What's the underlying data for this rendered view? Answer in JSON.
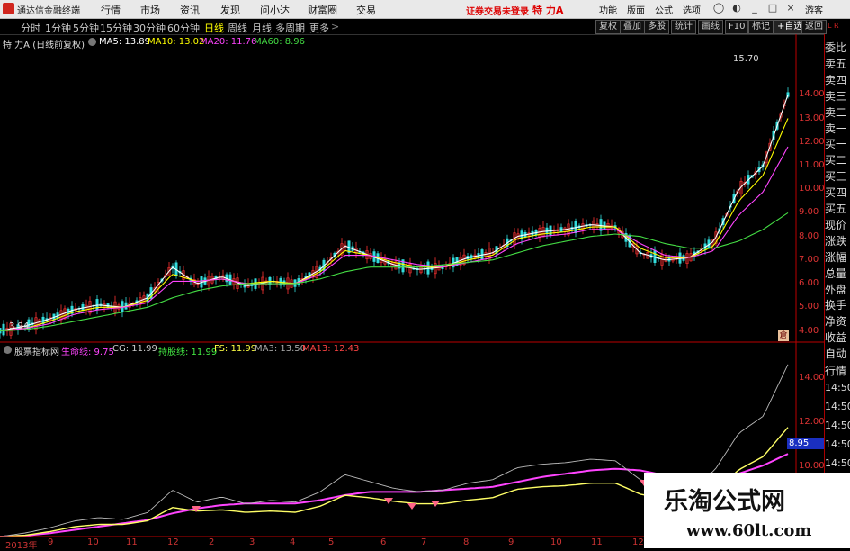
{
  "menubar": {
    "app_name": "通达信金融终端",
    "items": [
      "行情",
      "市场",
      "资讯",
      "发现",
      "问小达",
      "财富圈",
      "交易"
    ],
    "status_text": "证券交易未登录",
    "stock_name": "特 力A",
    "right_items": [
      "功能",
      "版面",
      "公式",
      "选项"
    ],
    "guest": "游客"
  },
  "toolbar": {
    "periods": [
      "分时",
      "1分钟",
      "5分钟",
      "15分钟",
      "30分钟",
      "60分钟",
      "日线",
      "周线",
      "月线",
      "多周期",
      "更多"
    ],
    "active_period": "日线",
    "buttons": [
      "复权",
      "叠加",
      "多股",
      "统计",
      "画线",
      "F10",
      "标记",
      "+自选",
      "返回"
    ]
  },
  "main_indicator": {
    "title": "特 力A (日线前复权)",
    "items": [
      {
        "label": "MA5: 13.89",
        "color": "#ffffff"
      },
      {
        "label": "MA10: 13.02",
        "color": "#ffff00"
      },
      {
        "label": "MA20: 11.76",
        "color": "#ff44ff"
      },
      {
        "label": "MA60: 8.96",
        "color": "#44dd44"
      }
    ]
  },
  "sub_indicator": {
    "title": "股票指标网",
    "items": [
      {
        "label": "生命线: 9.75",
        "color": "#ff44ff"
      },
      {
        "label": "CG: 11.99",
        "color": "#cccccc"
      },
      {
        "label": "持股线: 11.99",
        "color": "#44ee44"
      },
      {
        "label": "FS: 11.99",
        "color": "#ffff44"
      },
      {
        "label": "MA3: 13.50",
        "color": "#aaaaaa"
      },
      {
        "label": "MA13: 12.43",
        "color": "#ff4444"
      }
    ]
  },
  "chart_data": {
    "type": "line",
    "price_axis": {
      "ticks": [
        "14.00",
        "13.00",
        "12.00",
        "11.00",
        "10.00",
        "9.00",
        "8.00",
        "7.00",
        "6.00",
        "5.00",
        "4.00"
      ],
      "ylim": [
        3.6,
        16.3
      ]
    },
    "sub_axis": {
      "ticks": [
        "14.00",
        "12.00",
        "10.00",
        "8.00"
      ],
      "current": "8.95"
    },
    "x_labels": [
      "2013年",
      "9",
      "10",
      "11",
      "12",
      "2",
      "3",
      "4",
      "5",
      "6",
      "7",
      "8",
      "9",
      "10",
      "11",
      "12"
    ],
    "annotations": {
      "high": "15.70",
      "low": "3.94",
      "badge": "倉"
    },
    "series": [
      {
        "name": "MA5",
        "color": "#ffffff",
        "values": [
          4.0,
          4.2,
          4.5,
          4.9,
          5.1,
          5.0,
          5.4,
          6.7,
          6.0,
          6.3,
          5.9,
          6.1,
          6.0,
          6.6,
          7.6,
          7.2,
          6.8,
          6.6,
          6.7,
          7.1,
          7.3,
          8.0,
          8.2,
          8.3,
          8.5,
          8.4,
          7.3,
          7.0,
          7.1,
          7.8,
          10.0,
          11.0,
          14.0
        ]
      },
      {
        "name": "MA10",
        "color": "#ffff00",
        "values": [
          4.0,
          4.1,
          4.4,
          4.8,
          5.0,
          5.0,
          5.3,
          6.4,
          6.1,
          6.2,
          6.0,
          6.1,
          6.0,
          6.5,
          7.4,
          7.2,
          6.9,
          6.7,
          6.7,
          7.0,
          7.2,
          7.9,
          8.1,
          8.2,
          8.4,
          8.4,
          7.5,
          7.1,
          7.1,
          7.6,
          9.5,
          10.6,
          13.0
        ]
      },
      {
        "name": "MA20",
        "color": "#ff44ff",
        "values": [
          4.0,
          4.1,
          4.3,
          4.7,
          4.9,
          5.0,
          5.2,
          6.1,
          6.1,
          6.2,
          6.0,
          6.0,
          6.0,
          6.4,
          7.2,
          7.2,
          7.0,
          6.8,
          6.7,
          6.9,
          7.1,
          7.7,
          8.0,
          8.1,
          8.3,
          8.3,
          7.7,
          7.2,
          7.1,
          7.4,
          8.9,
          9.9,
          11.8
        ]
      },
      {
        "name": "MA60",
        "color": "#44dd44",
        "values": [
          4.0,
          4.05,
          4.2,
          4.4,
          4.6,
          4.8,
          5.0,
          5.4,
          5.7,
          5.9,
          6.0,
          6.0,
          6.0,
          6.2,
          6.5,
          6.7,
          6.7,
          6.7,
          6.8,
          6.9,
          7.0,
          7.3,
          7.6,
          7.8,
          8.0,
          8.1,
          8.0,
          7.7,
          7.5,
          7.5,
          7.8,
          8.3,
          9.0
        ]
      }
    ]
  },
  "sidebar": {
    "items": [
      "委比",
      "卖五",
      "卖四",
      "卖三",
      "卖二",
      "卖一",
      "买一",
      "买二",
      "买三",
      "买四",
      "买五",
      "现价",
      "涨跌",
      "涨幅",
      "总量",
      "外盘",
      "换手",
      "净资",
      "收益"
    ],
    "lower_items": [
      "自动",
      "行情"
    ],
    "times": [
      "14:50",
      "14:50",
      "14:50",
      "14:50",
      "14:50",
      "14:50"
    ],
    "corner": "L R"
  },
  "watermark": {
    "title": "乐淘公式网",
    "url": "www.60lt.com"
  }
}
